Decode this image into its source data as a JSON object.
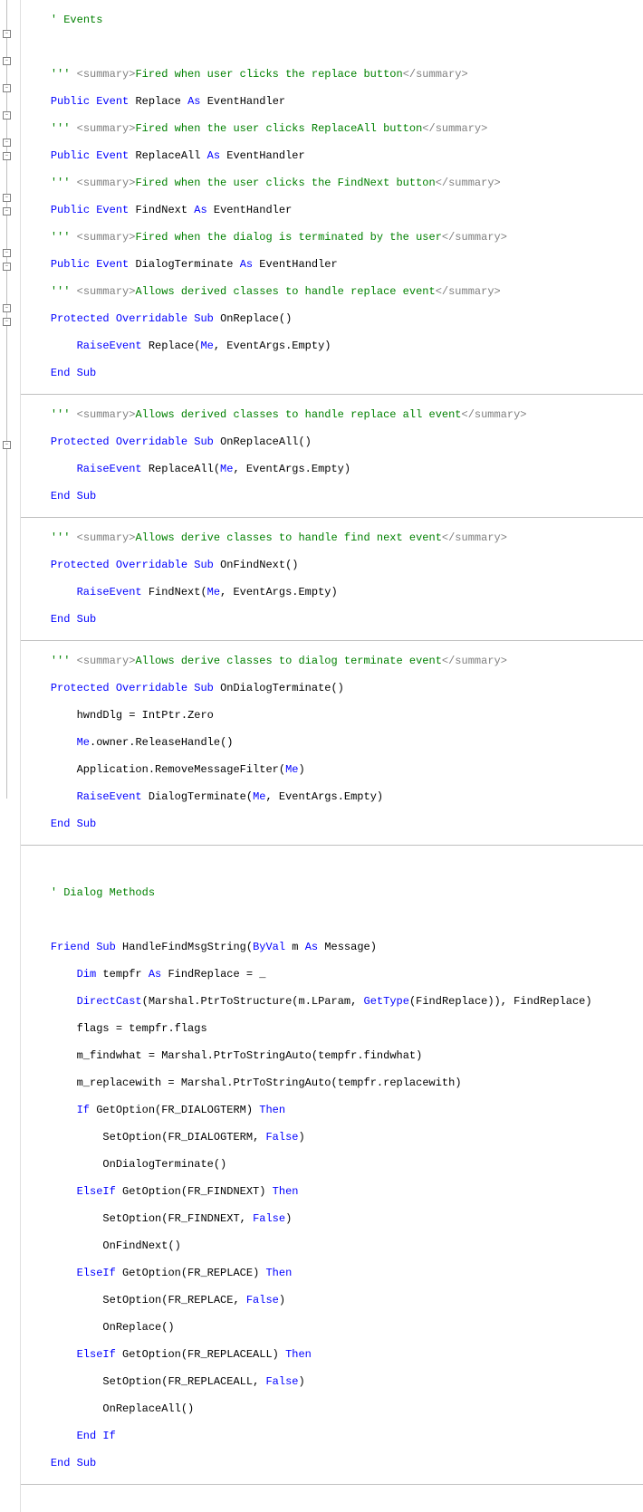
{
  "comments": {
    "eventsHeader": "' Events",
    "dialogMethodsHeader": "' Dialog Methods",
    "docPrefix": "''' ",
    "summaryOpen": "<summary>",
    "summaryClose": "</summary>",
    "sum1": "Fired when user clicks the replace button",
    "sum2": "Fired when the user clicks ReplaceAll button",
    "sum3": "Fired when the user clicks the FindNext button",
    "sum4": "Fired when the dialog is terminated by the user",
    "sum5": "Allows derived classes to handle replace event",
    "sum6": "Allows derived classes to handle replace all event",
    "sum7": "Allows derive classes to handle find next event",
    "sum8": "Allows derive classes to dialog terminate event"
  },
  "kw": {
    "Public": "Public",
    "Event": "Event",
    "As": "As",
    "Protected": "Protected",
    "Overridable": "Overridable",
    "Sub": "Sub",
    "End": "End",
    "RaiseEvent": "RaiseEvent",
    "Me": "Me",
    "Friend": "Friend",
    "ByVal": "ByVal",
    "Dim": "Dim",
    "DirectCast": "DirectCast",
    "GetType": "GetType",
    "If": "If",
    "Then": "Then",
    "ElseIf": "ElseIf",
    "False": "False"
  },
  "ident": {
    "Replace": "Replace",
    "ReplaceAll": "ReplaceAll",
    "FindNext": "FindNext",
    "DialogTerminate": "DialogTerminate",
    "EventHandler": "EventHandler",
    "OnReplace": "OnReplace",
    "OnReplaceAll": "OnReplaceAll",
    "OnFindNext": "OnFindNext",
    "OnDialogTerminate": "OnDialogTerminate",
    "EventArgs": "EventArgs",
    "Empty": "Empty",
    "hwndDlg": "hwndDlg",
    "IntPtr": "IntPtr",
    "Zero": "Zero",
    "owner": "owner",
    "ReleaseHandle": "ReleaseHandle",
    "Application": "Application",
    "RemoveMessageFilter": "RemoveMessageFilter",
    "HandleFindMsgString": "HandleFindMsgString",
    "m": "m",
    "Message": "Message",
    "tempfr": "tempfr",
    "FindReplace": "FindReplace",
    "Marshal": "Marshal",
    "PtrToStructure": "PtrToStructure",
    "LParam": "LParam",
    "flags": "flags",
    "m_findwhat": "m_findwhat",
    "PtrToStringAuto": "PtrToStringAuto",
    "findwhat": "findwhat",
    "m_replacewith": "m_replacewith",
    "replacewith": "replacewith",
    "GetOption": "GetOption",
    "SetOption": "SetOption",
    "FR_DIALOGTERM": "FR_DIALOGTERM",
    "FR_FINDNEXT": "FR_FINDNEXT",
    "FR_REPLACE": "FR_REPLACE",
    "FR_REPLACEALL": "FR_REPLACEALL",
    "EndIf": "End If",
    "EndSub": "End Sub",
    "underscore": " _"
  },
  "indent": {
    "i1": "    ",
    "i2": "        ",
    "i3": "            "
  }
}
